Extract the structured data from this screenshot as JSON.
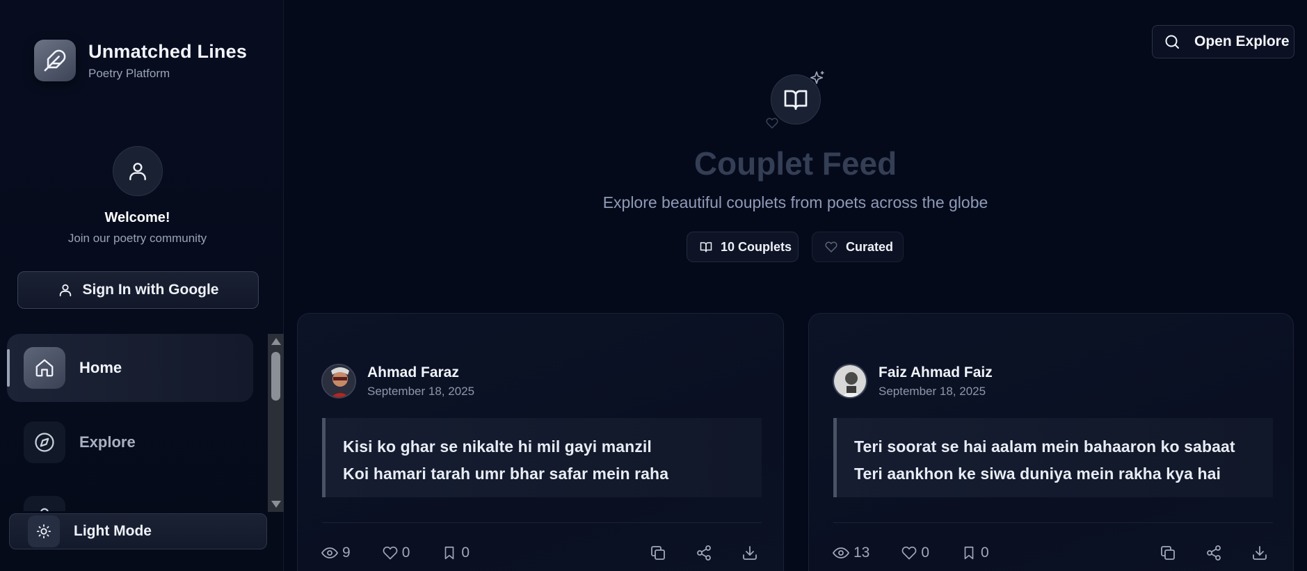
{
  "brand": {
    "title": "Unmatched Lines",
    "subtitle": "Poetry Platform",
    "logo_icon": "feather-icon"
  },
  "profile": {
    "welcome": "Welcome!",
    "tagline": "Join our poetry community",
    "avatar_icon": "user-icon"
  },
  "signin": {
    "label": "Sign In with Google",
    "icon": "user-icon"
  },
  "nav": {
    "items": [
      {
        "label": "Home",
        "icon": "home-icon",
        "active": true
      },
      {
        "label": "Explore",
        "icon": "compass-icon",
        "active": false
      },
      {
        "label": "",
        "icon": "lock-icon",
        "active": false
      }
    ]
  },
  "theme_toggle": {
    "label": "Light Mode",
    "icon": "sun-icon"
  },
  "header": {
    "open_explore_label": "Open Explore",
    "search_icon": "search-icon"
  },
  "hero": {
    "title": "Couplet Feed",
    "subtitle": "Explore beautiful couplets from poets across the globe",
    "count_label": "10 Couplets",
    "curated_label": "Curated"
  },
  "cards": [
    {
      "author": "Ahmad Faraz",
      "date": "September 18, 2025",
      "line1": "Kisi ko ghar se nikalte hi mil gayi manzil",
      "line2": "Koi hamari tarah umr bhar safar mein raha",
      "views": "9",
      "likes": "0",
      "saves": "0"
    },
    {
      "author": "Faiz Ahmad Faiz",
      "date": "September 18, 2025",
      "line1": "Teri soorat se hai aalam mein bahaaron ko sabaat",
      "line2": "Teri aankhon ke siwa duniya mein rakha kya hai",
      "views": "13",
      "likes": "0",
      "saves": "0"
    }
  ],
  "colors": {
    "background": "#050a1a",
    "accent": "#9aa3b6",
    "title_muted": "#343e55"
  }
}
